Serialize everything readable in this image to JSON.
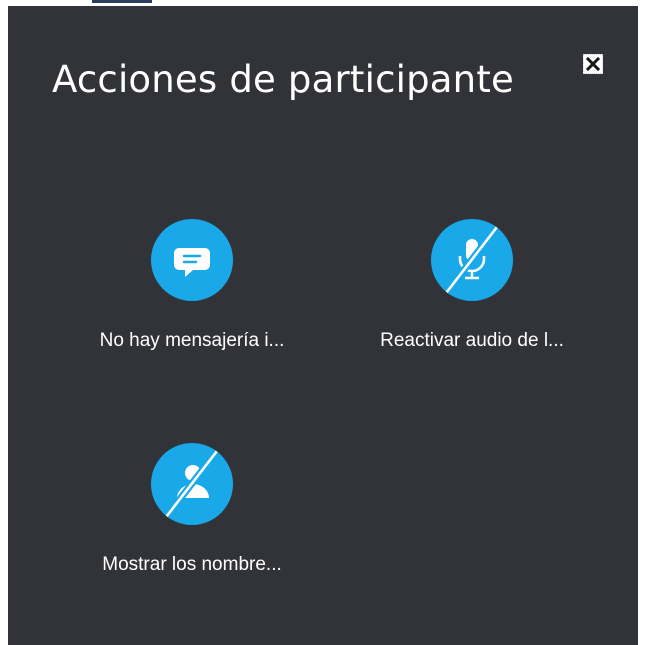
{
  "dialog": {
    "title": "Acciones de participante",
    "close_label": "X"
  },
  "actions": [
    {
      "label": "No hay mensajería i...",
      "icon": "chat-bubble-icon"
    },
    {
      "label": "Reactivar audio de l...",
      "icon": "microphone-off-icon"
    },
    {
      "label": "Mostrar los nombre...",
      "icon": "person-off-icon"
    }
  ],
  "colors": {
    "panel_bg": "#323338",
    "accent": "#19a9e8",
    "text": "#ffffff"
  }
}
